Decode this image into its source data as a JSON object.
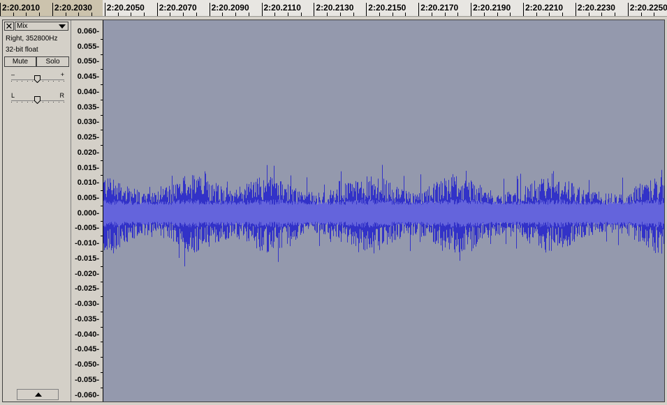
{
  "ruler": {
    "labels": [
      "2:20.2010",
      "2:20.2030",
      "2:20.2050",
      "2:20.2070",
      "2:20.2090",
      "2:20.2110",
      "2:20.2130",
      "2:20.2150",
      "2:20.2170",
      "2:20.2190",
      "2:20.2210",
      "2:20.2230",
      "2:20.2250"
    ]
  },
  "track": {
    "close_glyph": "✕",
    "name": "Mix",
    "channel_rate": "Right, 352800Hz",
    "format": "32-bit float",
    "mute_label": "Mute",
    "solo_label": "Solo",
    "gain_minus": "–",
    "gain_plus": "+",
    "pan_left": "L",
    "pan_right": "R"
  },
  "amplitude_scale": [
    "0.060-",
    "0.055-",
    "0.050-",
    "0.045-",
    "0.040-",
    "0.035-",
    "0.030-",
    "0.025-",
    "0.020-",
    "0.015-",
    "0.010-",
    "0.005-",
    "0.000-",
    "-0.005-",
    "-0.010-",
    "-0.015-",
    "-0.020-",
    "-0.025-",
    "-0.030-",
    "-0.035-",
    "-0.040-",
    "-0.045-",
    "-0.050-",
    "-0.055-",
    "-0.060-"
  ],
  "colors": {
    "wave_background": "#9499ad",
    "wave_peak": "#3232c8",
    "wave_rms": "#6464dc",
    "ruler_selected": "#ccc3ad"
  }
}
